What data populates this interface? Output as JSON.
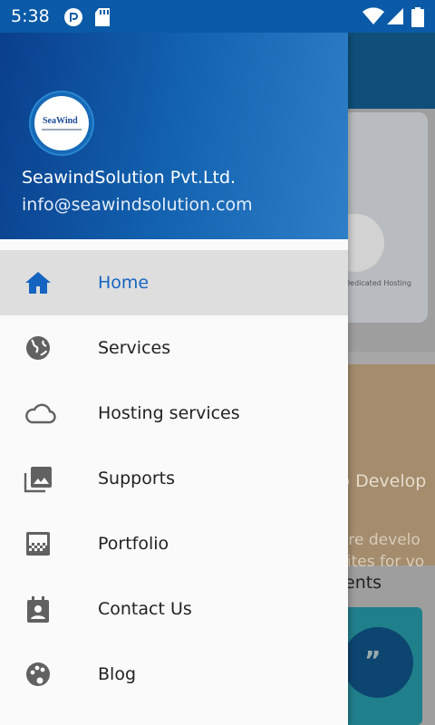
{
  "status_bar": {
    "time": "5:38",
    "left_icons": [
      "pocket-casts-icon",
      "sd-card-icon"
    ],
    "right_icons": [
      "wifi-icon",
      "signal-icon",
      "battery-icon"
    ]
  },
  "drawer": {
    "header": {
      "logo_text": "SeaWind",
      "company_name": "SeawindSolution Pvt.Ltd.",
      "email": "info@seawindsolution.com"
    },
    "menu": [
      {
        "label": "Home",
        "icon": "home-icon",
        "active": true
      },
      {
        "label": "Services",
        "icon": "globe-icon",
        "active": false
      },
      {
        "label": "Hosting services",
        "icon": "cloud-icon",
        "active": false
      },
      {
        "label": "Supports",
        "icon": "photo-library-icon",
        "active": false
      },
      {
        "label": "Portfolio",
        "icon": "gradient-pattern-icon",
        "active": false
      },
      {
        "label": "Contact Us",
        "icon": "contact-badge-icon",
        "active": false
      },
      {
        "label": "Blog",
        "icon": "palette-icon",
        "active": false
      }
    ]
  },
  "background": {
    "card_text_1": "Dedicated Hosting",
    "card_text_2": "b Develop",
    "card_text_3": "are develo",
    "card_text_4": "sites for vo",
    "section_text": "ents"
  },
  "colors": {
    "status_bar": "#0a5aa7",
    "header_gradient_start": "#0a3f8c",
    "header_gradient_end": "#2f7ec8",
    "active_accent": "#1565c0",
    "active_bg": "#dedede"
  }
}
